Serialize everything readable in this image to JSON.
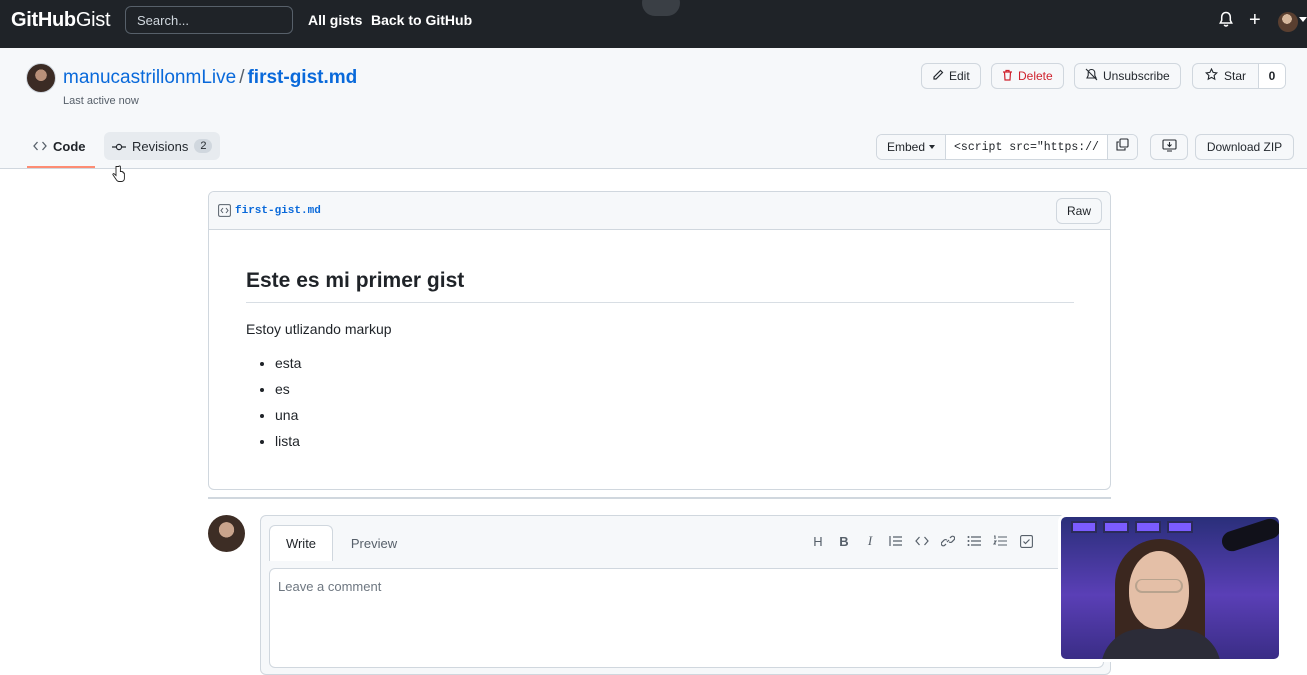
{
  "header": {
    "logo_bold": "GitHub",
    "logo_light": "Gist",
    "search_placeholder": "Search...",
    "nav": [
      "All gists",
      "Back to GitHub"
    ],
    "plus_symbol": "+"
  },
  "gist": {
    "owner": "manucastrillonmLive",
    "separator": "/",
    "filename": "first-gist.md",
    "last_active": "Last active now",
    "actions": {
      "edit": "Edit",
      "delete": "Delete",
      "unsubscribe": "Unsubscribe",
      "star": "Star",
      "star_count": "0"
    },
    "tabs": {
      "code": "Code",
      "revisions": "Revisions",
      "revisions_count": "2"
    },
    "embed": {
      "label": "Embed",
      "value": "<script src=\"https://"
    },
    "download": "Download ZIP"
  },
  "file": {
    "name": "first-gist.md",
    "raw": "Raw",
    "heading": "Este es mi primer gist",
    "paragraph": "Estoy utlizando markup",
    "list": [
      "esta",
      "es",
      "una",
      "lista"
    ]
  },
  "comment": {
    "tabs": [
      "Write",
      "Preview"
    ],
    "toolbar": [
      "H",
      "B",
      "I"
    ],
    "placeholder": "Leave a comment"
  },
  "colors": {
    "header_bg": "#1f2328",
    "link": "#0969da",
    "danger": "#cf222e",
    "tab_underline": "#fd8c73"
  }
}
